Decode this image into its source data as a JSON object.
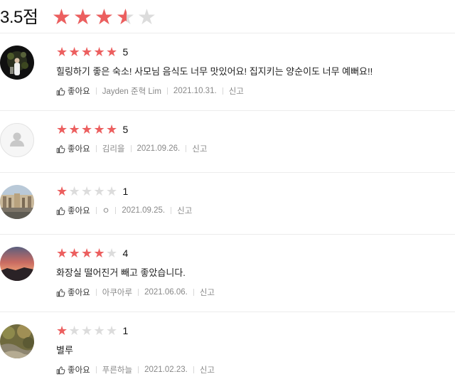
{
  "summary": {
    "score_text": "3.5점",
    "rating": 3.5,
    "max": 5
  },
  "like_label": "좋아요",
  "report_label": "신고",
  "colors": {
    "star_on": "#ec5f5f",
    "star_off": "#dcdcdc"
  },
  "reviews": [
    {
      "rating": 5,
      "rating_text": "5",
      "content": "힐링하기 좋은 숙소! 사모님 음식도 너무 맛있어요! 집지키는 양순이도 너무 예뻐요!!",
      "author": "Jayden 준혁 Lim",
      "date": "2021.10.31.",
      "avatar": "night-photo"
    },
    {
      "rating": 5,
      "rating_text": "5",
      "content": "",
      "author": "김리을",
      "date": "2021.09.26.",
      "avatar": "default-person"
    },
    {
      "rating": 1,
      "rating_text": "1",
      "content": "",
      "author": "ㅇ",
      "date": "2021.09.25.",
      "avatar": "building-photo"
    },
    {
      "rating": 4,
      "rating_text": "4",
      "content": "화장실 떨어진거 빼고 좋았습니다.",
      "author": "아쿠아루",
      "date": "2021.06.06.",
      "avatar": "sunset-photo"
    },
    {
      "rating": 1,
      "rating_text": "1",
      "content": "별루",
      "author": "푸른하늘",
      "date": "2021.02.23.",
      "avatar": "garden-photo"
    }
  ]
}
